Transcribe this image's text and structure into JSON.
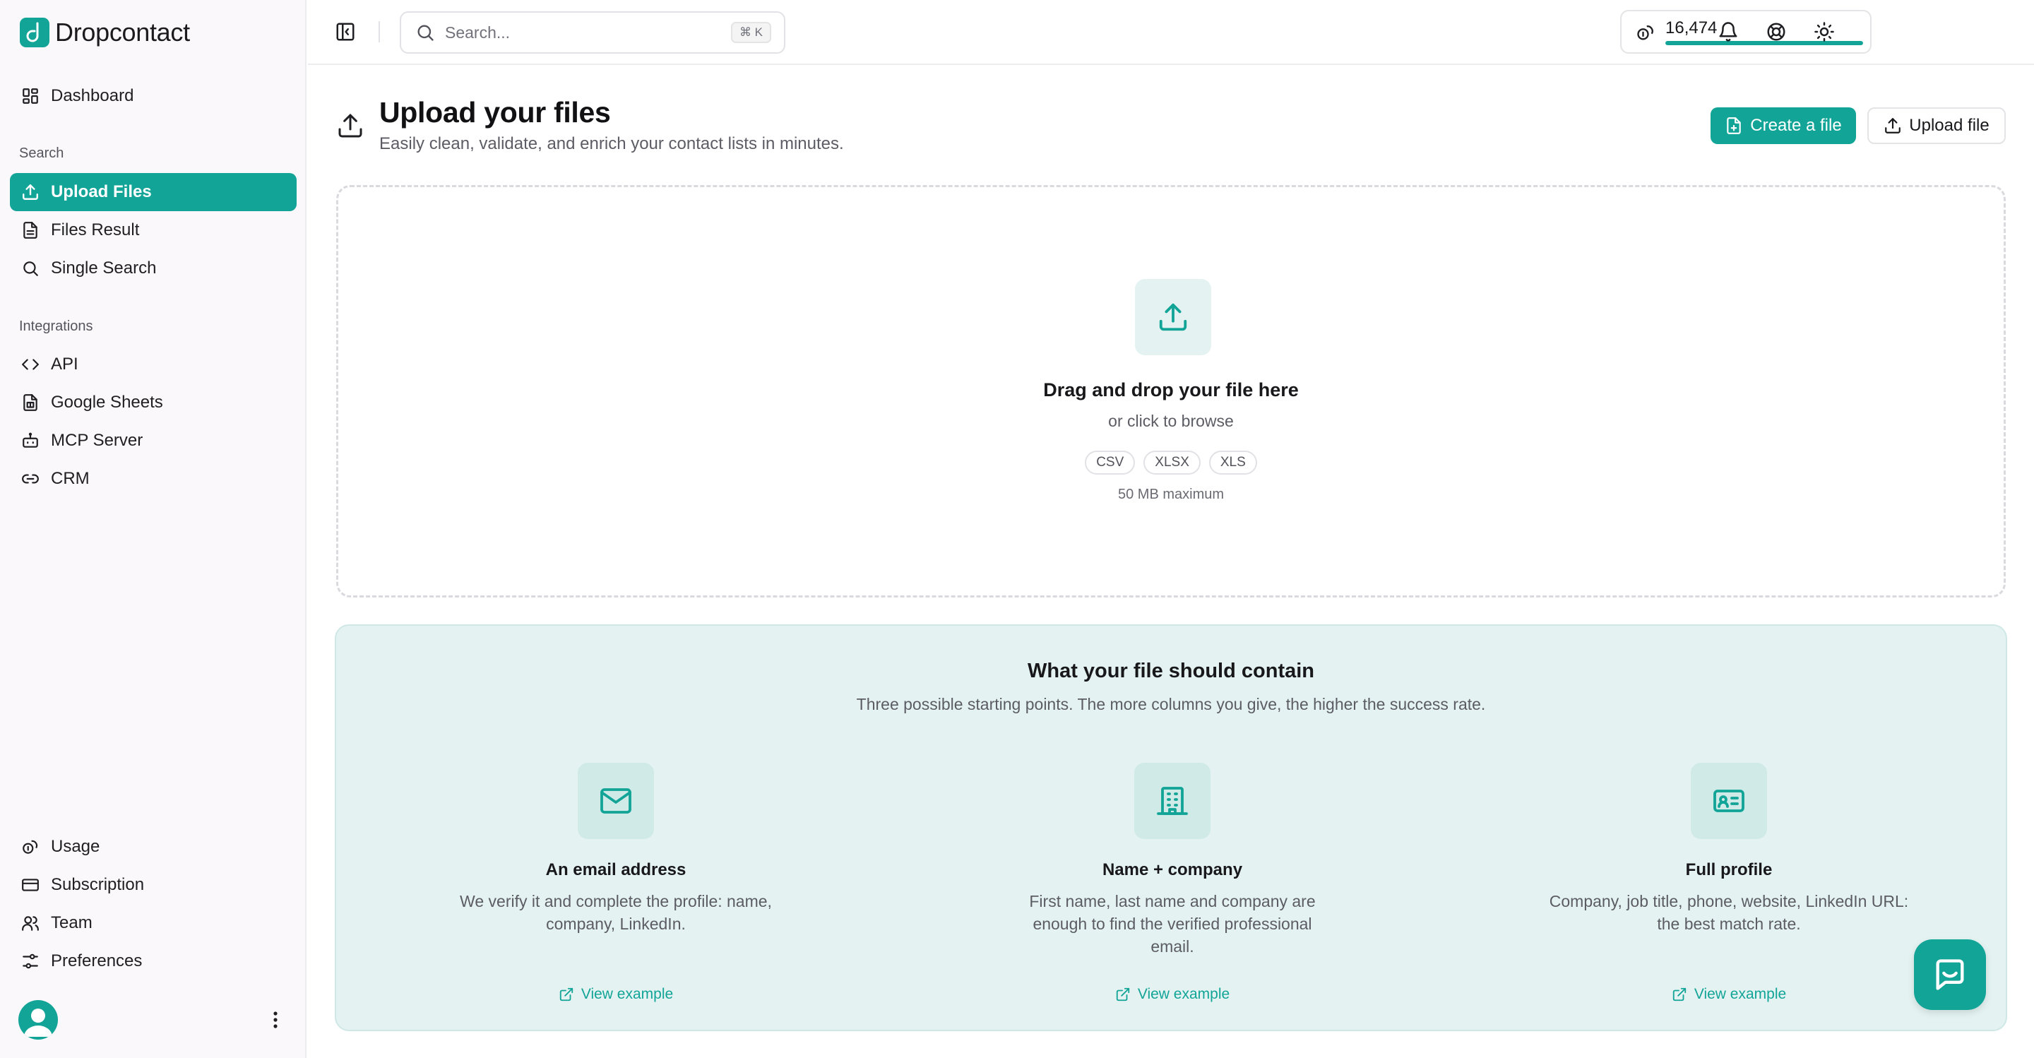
{
  "brand": {
    "name": "Dropcontact",
    "accent": "#12a497"
  },
  "sidebar": {
    "dashboard": {
      "label": "Dashboard",
      "icon": "dashboard-icon"
    },
    "section_search": "Search",
    "search_items": [
      {
        "label": "Upload Files",
        "icon": "upload-icon",
        "active": true
      },
      {
        "label": "Files Result",
        "icon": "file-text-icon"
      },
      {
        "label": "Single Search",
        "icon": "search-icon"
      }
    ],
    "section_integrations": "Integrations",
    "integration_items": [
      {
        "label": "API",
        "icon": "code-icon"
      },
      {
        "label": "Google Sheets",
        "icon": "sheet-icon"
      },
      {
        "label": "MCP Server",
        "icon": "bot-icon"
      },
      {
        "label": "CRM",
        "icon": "link-icon"
      }
    ],
    "bottom_items": [
      {
        "label": "Usage",
        "icon": "coins-icon"
      },
      {
        "label": "Subscription",
        "icon": "credit-card-icon"
      },
      {
        "label": "Team",
        "icon": "users-icon"
      },
      {
        "label": "Preferences",
        "icon": "sliders-icon"
      }
    ]
  },
  "topbar": {
    "search_placeholder": "Search...",
    "shortcut": "⌘ K",
    "credits": "16,474",
    "credits_progress": 1.0
  },
  "page": {
    "title": "Upload your files",
    "subtitle": "Easily clean, validate, and enrich your contact lists in minutes.",
    "create_button": "Create a file",
    "upload_button": "Upload file"
  },
  "dropzone": {
    "title": "Drag and drop your file here",
    "subtitle": "or click to browse",
    "formats": [
      "CSV",
      "XLSX",
      "XLS"
    ],
    "max_size": "50 MB maximum"
  },
  "requirements": {
    "title": "What your file should contain",
    "subtitle": "Three possible starting points. The more columns you give, the higher the success rate.",
    "columns": [
      {
        "icon": "mail-icon",
        "title": "An email address",
        "description": "We verify it and complete the profile: name, company, LinkedIn.",
        "link": "View example"
      },
      {
        "icon": "building-icon",
        "title": "Name + company",
        "description": "First name, last name and company are enough to find the verified professional email.",
        "link": "View example"
      },
      {
        "icon": "id-card-icon",
        "title": "Full profile",
        "description": "Company, job title, phone, website, LinkedIn URL: the best match rate.",
        "link": "View example"
      }
    ]
  }
}
